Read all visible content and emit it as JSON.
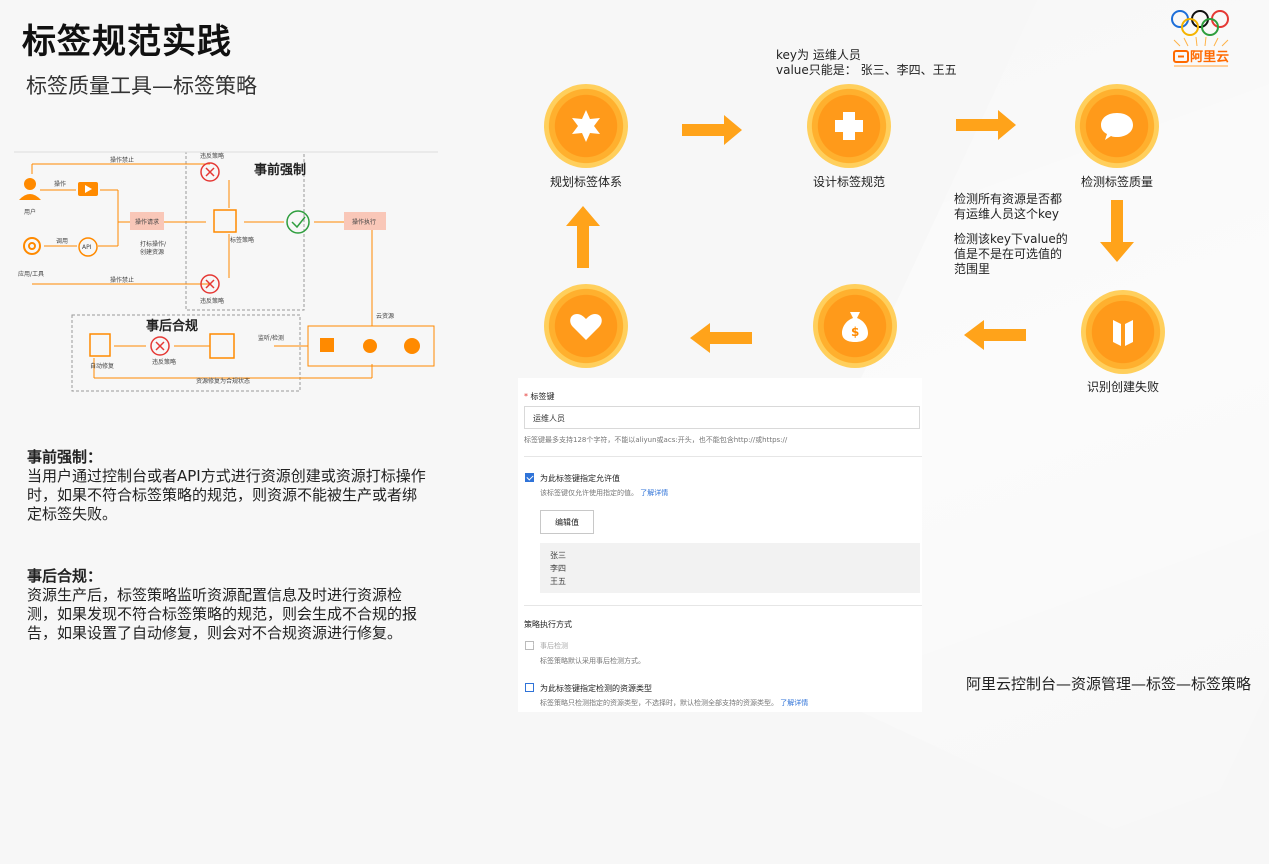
{
  "title": "标签规范实践",
  "subtitle": "标签质量工具—标签策略",
  "flow": {
    "op_forbid_top": "操作禁止",
    "op_forbid_bottom": "操作禁止",
    "violate_top": "违反策略",
    "violate_bottom": "违反策略",
    "violate_post": "违反策略",
    "pre_title": "事前强制",
    "post_title": "事后合规",
    "op": "操作",
    "call": "调用",
    "user": "用户",
    "app": "应用/工具",
    "op_request": "操作请求",
    "tag_op": "打标操作/",
    "create_res": "创建资源",
    "tag_policy": "标签策略",
    "op_exec": "操作执行",
    "cloud_res": "云资源",
    "monitor": "监听/检测",
    "auto_fix": "自动修复",
    "fixed": "资源修复为合规状态",
    "api": "API"
  },
  "pre": {
    "heading": "事前强制：",
    "body": "当用户通过控制台或者API方式进行资源创建或资源打标操作时，如果不符合标签策略的规范，则资源不能被生产或者绑定标签失败。"
  },
  "post": {
    "heading": "事后合规：",
    "body": "资源生产后，标签策略监听资源配置信息及时进行资源检测，如果发现不符合标签策略的规范，则会生成不合规的报告，如果设置了自动修复，则会对不合规资源进行修复。"
  },
  "cycle": {
    "key_note_1": "key为 运维人员",
    "key_note_2": "value只能是： 张三、李四、王五",
    "c1": "规划标签体系",
    "c2": "设计标签规范",
    "c3": "检测标签质量",
    "c4": "识别创建失败",
    "check_1a": "检测所有资源是否都",
    "check_1b": "有运维人员这个key",
    "check_2a": "检测该key下value的",
    "check_2b": "值是不是在可选值的",
    "check_2c": "范围里"
  },
  "form": {
    "req_star": "*",
    "key_label": "标签键",
    "key_value": "运维人员",
    "key_hint": "标签键最多支持128个字符，不能以aliyun或acs:开头，也不能包含http://或https://",
    "allow_label": "为此标签键指定允许值",
    "allow_hint": "该标签键仅允许使用指定的值。",
    "learn_more": "了解详情",
    "edit_btn": "编辑值",
    "values": [
      "张三",
      "李四",
      "王五"
    ],
    "mode_label": "策略执行方式",
    "post_check": "事后检测",
    "post_check_hint": "标签策略默认采用事后检测方式。",
    "res_type_label": "为此标签键指定检测的资源类型",
    "res_type_hint": "标签策略只检测指定的资源类型，不选择时，默认检测全部支持的资源类型。",
    "learn_more_2": "了解详情"
  },
  "footer": "阿里云控制台—资源管理—标签—标签策略",
  "logo_text": "阿里云",
  "colors": {
    "orange": "#ff8a00",
    "red": "#e53935",
    "green": "#2e9e3e",
    "blue": "#2f73d8"
  }
}
